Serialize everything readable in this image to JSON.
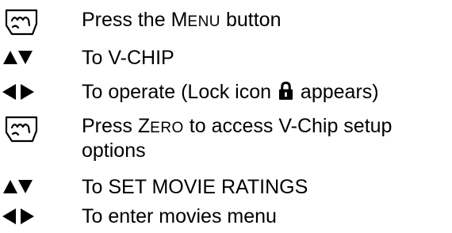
{
  "steps": [
    {
      "icon": "hand-press-icon",
      "text": {
        "before": "Press the ",
        "sc_first": "M",
        "sc_rest": "ENU",
        "after": " button"
      }
    },
    {
      "icon": "up-down-arrows-icon",
      "text": "To V-CHIP"
    },
    {
      "icon": "left-right-arrows-icon",
      "text": {
        "before": "To operate (Lock icon ",
        "after": " appears)"
      }
    },
    {
      "icon": "hand-press-icon",
      "text": {
        "before": "Press ",
        "sc_first": "Z",
        "sc_rest": "ERO",
        "after": " to access V-Chip setup options"
      }
    },
    {
      "icon": "up-down-arrows-icon",
      "text": "To SET MOVIE RATINGS"
    },
    {
      "icon": "left-right-arrows-icon",
      "text": "To enter movies menu"
    }
  ],
  "inline_icon": "lock-icon"
}
